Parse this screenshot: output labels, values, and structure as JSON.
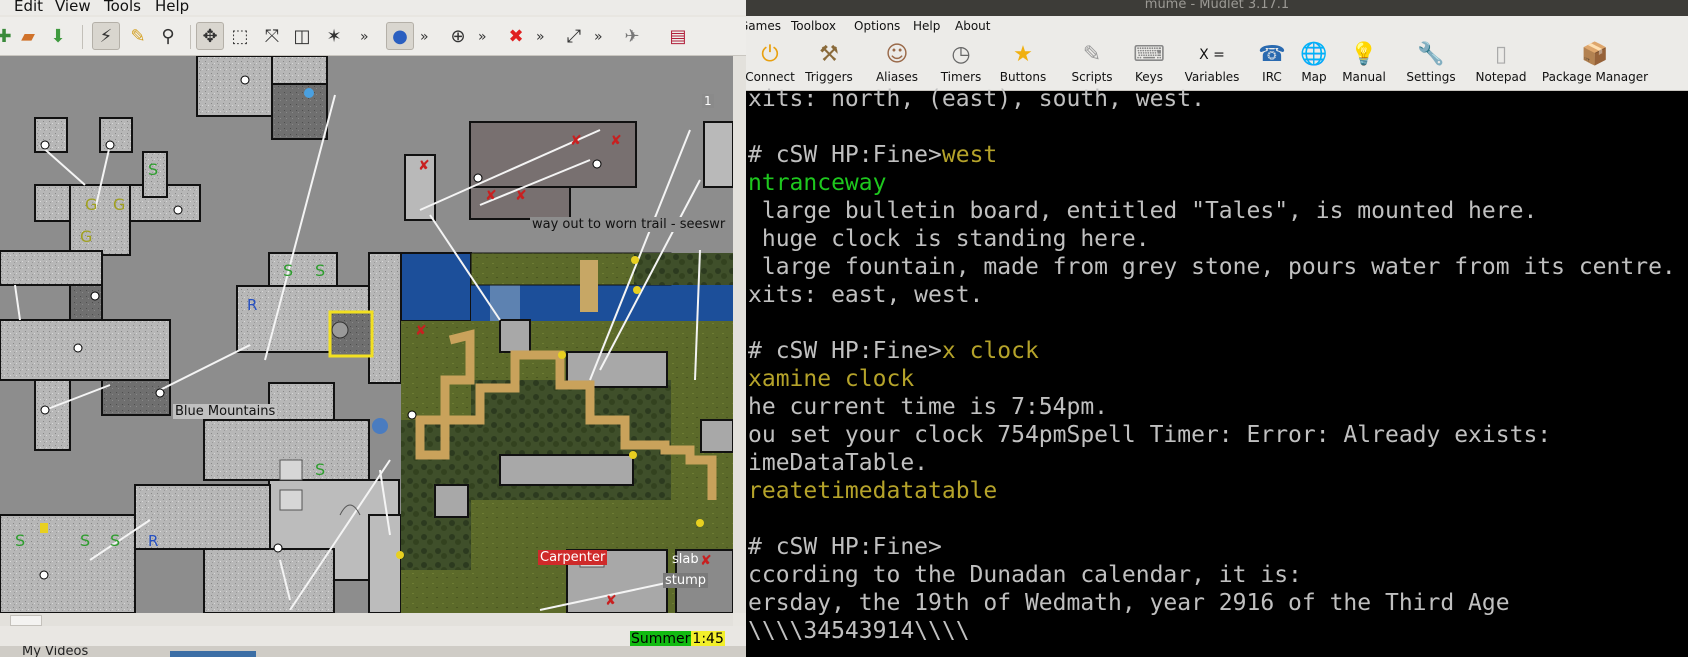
{
  "mapper": {
    "menu": [
      "Edit",
      "View",
      "Tools",
      "Help"
    ],
    "toolbar_more": "»",
    "labels": {
      "way_out": "way out to worn trail - seeswr",
      "blue_mountains": "Blue Mountains",
      "carpenter": "Carpenter",
      "slab": "slab",
      "stump": "stump",
      "level": "1"
    },
    "season": "Summer",
    "time": "1:45",
    "taskbar_item": "My Videos"
  },
  "mudlet": {
    "title": "mume - Mudlet 3.17.1",
    "menu": [
      "Games",
      "Toolbox",
      "Options",
      "Help",
      "About"
    ],
    "toolbar": [
      {
        "label": "Connect",
        "icon": "connect-icon"
      },
      {
        "label": "Triggers",
        "icon": "triggers-icon"
      },
      {
        "label": "Aliases",
        "icon": "aliases-icon"
      },
      {
        "label": "Timers",
        "icon": "timers-icon"
      },
      {
        "label": "Buttons",
        "icon": "buttons-icon"
      },
      {
        "label": "Scripts",
        "icon": "scripts-icon"
      },
      {
        "label": "Keys",
        "icon": "keys-icon"
      },
      {
        "label": "Variables",
        "icon": "variables-icon"
      },
      {
        "label": "IRC",
        "icon": "irc-icon"
      },
      {
        "label": "Map",
        "icon": "map-icon"
      },
      {
        "label": "Manual",
        "icon": "manual-icon"
      },
      {
        "label": "Settings",
        "icon": "settings-icon"
      },
      {
        "label": "Notepad",
        "icon": "notepad-icon"
      },
      {
        "label": "Package Manager",
        "icon": "package-manager-icon"
      }
    ],
    "variables_glyph": "X =",
    "console_lines": [
      {
        "text": "xits: north, (east), south, west.",
        "color": "gray"
      },
      {
        "text": "",
        "color": "gray"
      },
      {
        "prompt": "# cSW HP:Fine>",
        "cmd": "west"
      },
      {
        "text": "ntranceway",
        "color": "green"
      },
      {
        "text": " large bulletin board, entitled \"Tales\", is mounted here.",
        "color": "gray"
      },
      {
        "text": " huge clock is standing here.",
        "color": "gray"
      },
      {
        "text": " large fountain, made from grey stone, pours water from its centre.",
        "color": "gray"
      },
      {
        "text": "xits: east, west.",
        "color": "gray"
      },
      {
        "text": "",
        "color": "gray"
      },
      {
        "prompt": "# cSW HP:Fine>",
        "cmd": "x clock"
      },
      {
        "text": "xamine clock",
        "color": "yellow"
      },
      {
        "text": "he current time is 7:54pm.",
        "color": "gray"
      },
      {
        "text": "ou set your clock 754pmSpell Timer: Error: Already exists:",
        "color": "gray"
      },
      {
        "text": "imeDataTable.",
        "color": "gray"
      },
      {
        "text": "reatetimedatatable",
        "color": "yellow"
      },
      {
        "text": "",
        "color": "gray"
      },
      {
        "prompt": "# cSW HP:Fine>",
        "cmd": ""
      },
      {
        "text": "ccording to the Dunadan calendar, it is:",
        "color": "gray"
      },
      {
        "text": "ersday, the 19th of Wedmath, year 2916 of the Third Age",
        "color": "gray"
      },
      {
        "text": "\\\\\\\\34543914\\\\\\\\",
        "color": "gray"
      }
    ]
  }
}
